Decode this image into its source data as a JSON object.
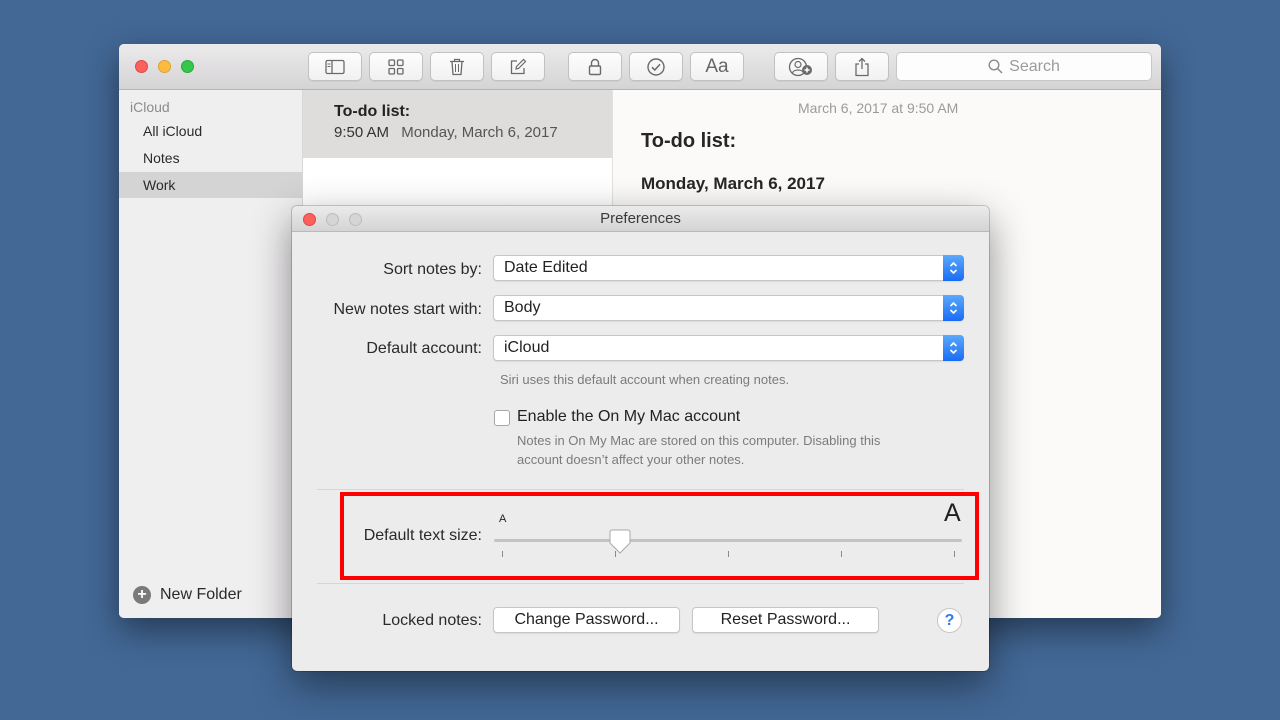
{
  "notes_window": {
    "toolbar": {
      "buttons": [
        {
          "icon": "sidebar-toggle-icon"
        },
        {
          "icon": "grid-view-icon"
        },
        {
          "icon": "trash-icon"
        },
        {
          "icon": "compose-icon"
        },
        {
          "icon": "lock-icon"
        },
        {
          "icon": "checklist-icon"
        },
        {
          "icon": "text-format-icon",
          "label": "Aa"
        },
        {
          "icon": "add-people-icon"
        },
        {
          "icon": "share-icon"
        }
      ],
      "search_placeholder": "Search"
    },
    "sidebar": {
      "section": "iCloud",
      "items": [
        {
          "label": "All iCloud",
          "selected": false
        },
        {
          "label": "Notes",
          "selected": false
        },
        {
          "label": "Work",
          "selected": true
        }
      ],
      "new_folder_label": "New Folder"
    },
    "note_list": [
      {
        "title": "To-do list:",
        "time": "9:50 AM",
        "date": "Monday, March 6, 2017"
      }
    ],
    "note_detail": {
      "timestamp": "March 6, 2017 at 9:50 AM",
      "title": "To-do list:",
      "subtitle": "Monday, March 6, 2017"
    }
  },
  "preferences": {
    "title": "Preferences",
    "sort_notes": {
      "label": "Sort notes by:",
      "value": "Date Edited"
    },
    "new_notes": {
      "label": "New notes start with:",
      "value": "Body"
    },
    "default_account": {
      "label": "Default account:",
      "value": "iCloud",
      "help": "Siri uses this default account when creating notes."
    },
    "on_my_mac": {
      "label": "Enable the On My Mac account",
      "checked": false,
      "help_line1": "Notes in On My Mac are stored on this computer. Disabling this",
      "help_line2": "account doesn’t affect your other notes."
    },
    "text_size": {
      "label": "Default text size:",
      "small_glyph": "A",
      "large_glyph": "A",
      "steps": 5,
      "value_fraction": 0.26
    },
    "locked_notes": {
      "label": "Locked notes:",
      "change_password": "Change Password...",
      "reset_password": "Reset Password...",
      "help_button": "?"
    },
    "highlight_color": "#ff0000"
  },
  "colors": {
    "desktop": "#436896",
    "accent_blue": "#1a6cf5",
    "close_red": "#fc605c",
    "minimize_yellow": "#fdbc40",
    "maximize_green": "#34c84a"
  }
}
